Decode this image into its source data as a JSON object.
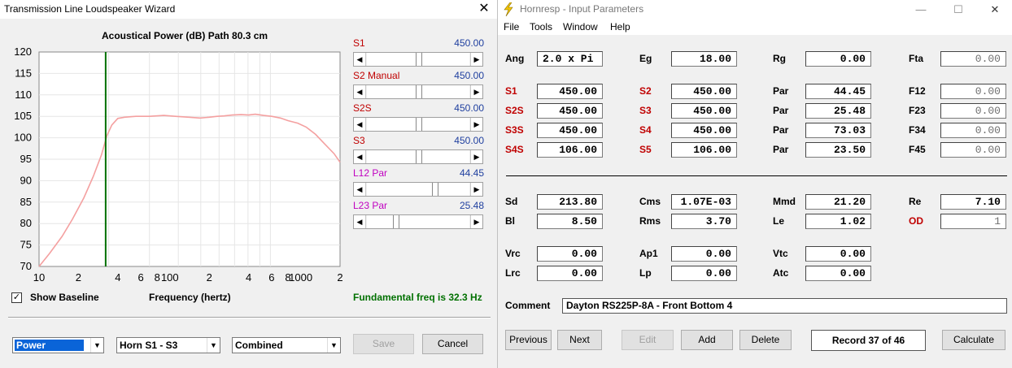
{
  "wizard": {
    "title": "Transmission Line Loudspeaker Wizard",
    "chart_heading": "Acoustical Power (dB)   Path 80.3 cm",
    "params": [
      {
        "label": "S1",
        "value": "450.00"
      },
      {
        "label": "S2  Manual",
        "value": "450.00"
      },
      {
        "label": "S2S",
        "value": "450.00"
      },
      {
        "label": "S3",
        "value": "450.00"
      },
      {
        "label": "L12  Par",
        "value": "44.45"
      },
      {
        "label": "L23  Par",
        "value": "25.48"
      }
    ],
    "show_baseline_label": "Show Baseline",
    "show_baseline_checked": true,
    "xaxis_title": "Frequency (hertz)",
    "fundamental": "Fundamental freq is 32.3 Hz",
    "combo_type": "Power",
    "combo_horn": "Horn S1 - S3",
    "combo_mode": "Combined",
    "save_label": "Save",
    "cancel_label": "Cancel"
  },
  "chart_data": {
    "type": "line",
    "title": "Acoustical Power (dB)   Path 80.3 cm",
    "xlabel": "Frequency (hertz)",
    "ylabel": "",
    "x_scale": "log",
    "xlim": [
      10,
      200
    ],
    "ylim": [
      70,
      120
    ],
    "yticks": [
      70,
      75,
      80,
      85,
      90,
      95,
      100,
      105,
      110,
      115,
      120
    ],
    "xtick_labels": [
      "10",
      "2",
      "4",
      "6",
      "8",
      "100",
      "2",
      "4",
      "6",
      "8",
      "1000",
      "2"
    ],
    "xtick_values": [
      10,
      20,
      40,
      60,
      80,
      100,
      200,
      400,
      600,
      800,
      1000,
      2000
    ],
    "marker_freq": 32.3,
    "series": [
      {
        "color": "#f4a0a0",
        "x": [
          10,
          12,
          15,
          18,
          22,
          26,
          30,
          33,
          36,
          40,
          45,
          55,
          70,
          90,
          110,
          140,
          170,
          200,
          230,
          260,
          300,
          350,
          400,
          450,
          520,
          600,
          700,
          800,
          950,
          1100,
          1300,
          1500,
          1800,
          2000
        ],
        "y": [
          70,
          73,
          77,
          81,
          86,
          91,
          96,
          100.5,
          103,
          104.5,
          104.8,
          105,
          105,
          105.2,
          105,
          104.8,
          104.6,
          104.8,
          105,
          105.1,
          105.3,
          105.4,
          105.3,
          105.5,
          105.2,
          105,
          104.6,
          104,
          103.4,
          102.5,
          100.8,
          98.8,
          96.3,
          94.3
        ]
      }
    ]
  },
  "hornresp": {
    "title": "Hornresp - Input Parameters",
    "menu": [
      "File",
      "Tools",
      "Window",
      "Help"
    ],
    "rows1": [
      {
        "l1": "Ang",
        "v1": "2.0 x Pi",
        "l2": "Eg",
        "v2": "18.00",
        "l3": "Rg",
        "v3": "0.00",
        "l4": "Fta",
        "v4": "0.00"
      }
    ],
    "rows2": [
      {
        "l1": "S1",
        "v1": "450.00",
        "l2": "S2",
        "v2": "450.00",
        "l3": "Par",
        "v3": "44.45",
        "l4": "F12",
        "v4": "0.00"
      },
      {
        "l1": "S2S",
        "v1": "450.00",
        "l2": "S3",
        "v2": "450.00",
        "l3": "Par",
        "v3": "25.48",
        "l4": "F23",
        "v4": "0.00"
      },
      {
        "l1": "S3S",
        "v1": "450.00",
        "l2": "S4",
        "v2": "450.00",
        "l3": "Par",
        "v3": "73.03",
        "l4": "F34",
        "v4": "0.00"
      },
      {
        "l1": "S4S",
        "v1": "106.00",
        "l2": "S5",
        "v2": "106.00",
        "l3": "Par",
        "v3": "23.50",
        "l4": "F45",
        "v4": "0.00"
      }
    ],
    "rows3": [
      {
        "l1": "Sd",
        "v1": "213.80",
        "l2": "Cms",
        "v2": "1.07E-03",
        "l3": "Mmd",
        "v3": "21.20",
        "l4": "Re",
        "v4": "7.10"
      },
      {
        "l1": "Bl",
        "v1": "8.50",
        "l2": "Rms",
        "v2": "3.70",
        "l3": "Le",
        "v3": "1.02",
        "l4": "OD",
        "v4": "1"
      }
    ],
    "rows4": [
      {
        "l1": "Vrc",
        "v1": "0.00",
        "l2": "Ap1",
        "v2": "0.00",
        "l3": "Vtc",
        "v3": "0.00"
      },
      {
        "l1": "Lrc",
        "v1": "0.00",
        "l2": "Lp",
        "v2": "0.00",
        "l3": "Atc",
        "v3": "0.00"
      }
    ],
    "comment_label": "Comment",
    "comment": "Dayton RS225P-8A - Front Bottom 4",
    "buttons": {
      "previous": "Previous",
      "next": "Next",
      "edit": "Edit",
      "add": "Add",
      "delete": "Delete",
      "record": "Record 37 of 46",
      "calculate": "Calculate"
    }
  }
}
